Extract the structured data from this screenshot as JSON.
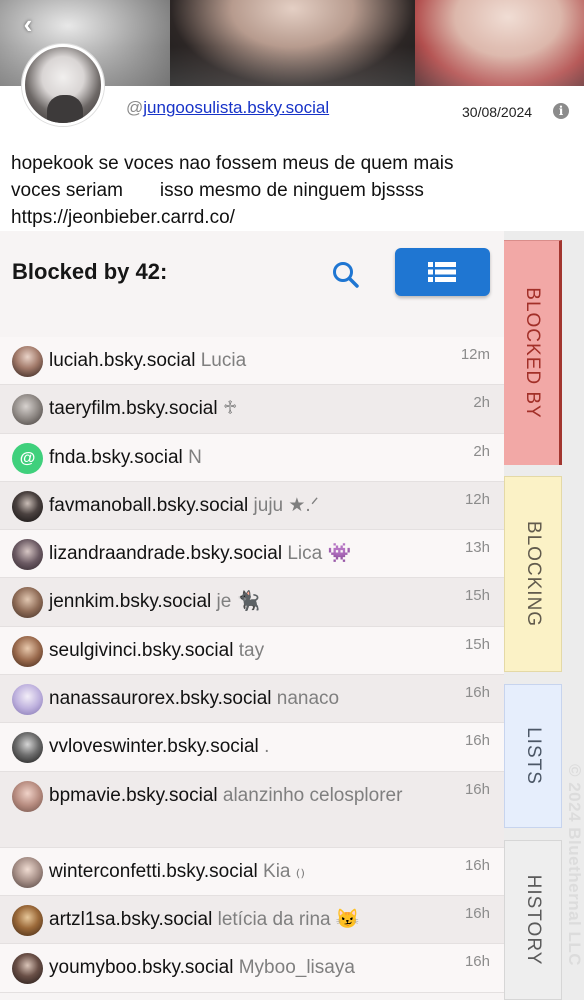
{
  "profile": {
    "handle_prefix": "@",
    "handle": "jungoosulista.bsky.social",
    "date": "30/08/2024",
    "bio": "hopekook se voces nao fossem meus de quem mais\nvoces seriam       isso mesmo de ninguem bjssss\nhttps://jeonbieber.carrd.co/"
  },
  "panel": {
    "title": "Blocked by 42:"
  },
  "icons": {
    "back": "chevron-left-icon",
    "info": "info-icon",
    "search": "search-icon",
    "list": "list-view-icon"
  },
  "colors": {
    "accent": "#1f76d2",
    "link": "#1733c8",
    "tab_blocked": "#f2a8a6",
    "tab_blocking": "#fbf2c6",
    "tab_lists": "#e6eefc",
    "tab_history": "#eeeeee"
  },
  "blockers": [
    {
      "handle": "luciah.bsky.social",
      "display": "Lucia",
      "time": "12m"
    },
    {
      "handle": "taeryfilm.bsky.social",
      "display": "♱",
      "time": "2h"
    },
    {
      "handle": "fnda.bsky.social",
      "display": "N",
      "time": "2h"
    },
    {
      "handle": "favmanoball.bsky.social",
      "display": "juju ★.ᐟ",
      "time": "12h"
    },
    {
      "handle": "lizandraandrade.bsky.social",
      "display": "Lica 👾",
      "time": "13h"
    },
    {
      "handle": "jennkim.bsky.social",
      "display": "je 🐈‍⬛",
      "time": "15h"
    },
    {
      "handle": "seulgivinci.bsky.social",
      "display": "tay",
      "time": "15h"
    },
    {
      "handle": "nanassaurorex.bsky.social",
      "display": "nanaco",
      "time": "16h"
    },
    {
      "handle": "vvloveswinter.bsky.social",
      "display": ".",
      "time": "16h"
    },
    {
      "handle": "bpmavie.bsky.social",
      "display": "alanzinho celosplorer",
      "time": "16h"
    },
    {
      "handle": "winterconfetti.bsky.social",
      "display": "Kia ₍₎",
      "time": "16h"
    },
    {
      "handle": "artzl1sa.bsky.social",
      "display": "letícia da rina 😼",
      "time": "16h"
    },
    {
      "handle": "youmyboo.bsky.social",
      "display": "Myboo_lisaya",
      "time": "16h"
    }
  ],
  "tabs": {
    "blocked_by": "BLOCKED BY",
    "blocking": "BLOCKING",
    "lists": "LISTS",
    "history": "HISTORY"
  },
  "copyright": "© 2024 Bluethernal LLC"
}
